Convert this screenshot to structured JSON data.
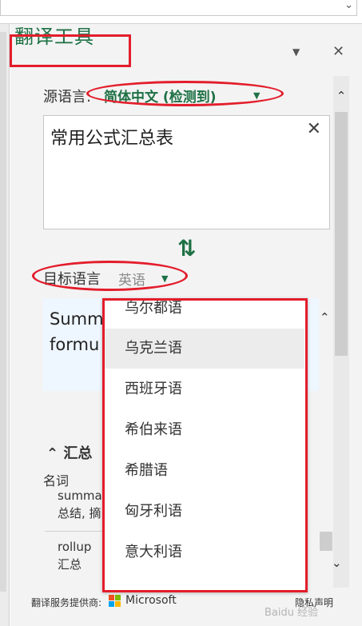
{
  "window": {
    "pane_title": "翻译工具",
    "menu_icon": "caret-down-icon",
    "close_icon": "close-icon"
  },
  "source": {
    "label": "源语言:",
    "language": "简体中文 (检测到)",
    "text": "常用公式汇总表",
    "clear_icon": "close-icon"
  },
  "swap_icon": "swap-arrows-icon",
  "target": {
    "label": "目标语言",
    "language": "英语",
    "text_line1": "Summ",
    "text_line2": "formu"
  },
  "dropdown": {
    "items": [
      "乌尔都语",
      "乌克兰语",
      "西班牙语",
      "希伯来语",
      "希腊语",
      "匈牙利语",
      "意大利语"
    ],
    "hovered_index": 1
  },
  "details": {
    "section_title": "汇总",
    "part_of_speech": "名词",
    "entries": [
      {
        "word": "summa",
        "translation": "总结, 摘"
      },
      {
        "word": "rollup",
        "translation": "汇总"
      }
    ]
  },
  "footer": {
    "provider_label": "翻译服务提供商:",
    "provider_name": "Microsoft",
    "privacy": "隐私声明",
    "watermark": "Baidu 经验"
  },
  "colors": {
    "accent": "#1e7145",
    "highlight": "#e31d2b",
    "target_bg": "#eef6ff"
  }
}
